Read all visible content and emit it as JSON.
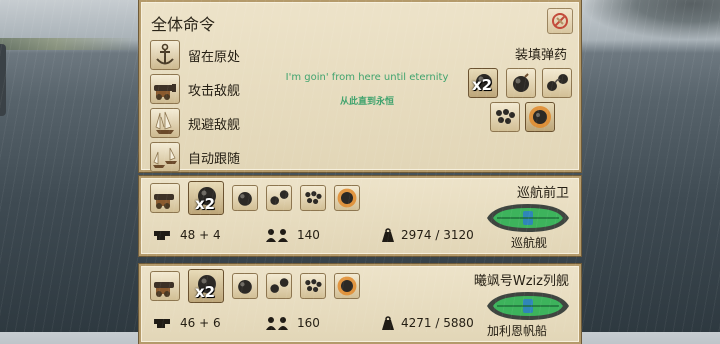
{
  "main": {
    "title": "全体命令",
    "orders": [
      {
        "label": "留在原处",
        "icon": "anchor-icon"
      },
      {
        "label": "攻击敌舰",
        "icon": "cannon-icon"
      },
      {
        "label": "规避敌舰",
        "icon": "sailing-ship-icon"
      },
      {
        "label": "自动跟随",
        "icon": "fleet-icon"
      }
    ],
    "quote_line1": "I'm goin' from here until eternity",
    "quote_line2": "从此直到永恒",
    "load_ammo_title": "装填弹药",
    "ammo": [
      {
        "icon": "cannonball-icon",
        "multiplier": "x2",
        "selected": true
      },
      {
        "icon": "bomb-icon"
      },
      {
        "icon": "chain-shot-icon"
      },
      {
        "icon": "grapeshot-icon"
      },
      {
        "icon": "explosive-shell-icon",
        "selected": true
      }
    ]
  },
  "ships": [
    {
      "name": "巡航前卫",
      "class": "巡航舰",
      "cannons": "48 + 4",
      "crew": "140",
      "cargo": "2974 / 3120",
      "multiplier": "x2"
    },
    {
      "name": "曦飒号Wziz列舰",
      "class": "加利恩帆船",
      "cannons": "46 + 6",
      "crew": "160",
      "cargo": "4271 / 5880",
      "multiplier": "x2"
    }
  ],
  "colors": {
    "panel": "#e8ddc1",
    "border": "#b49a6a",
    "quote": "#3fa36d",
    "hull_green": "#3db35c",
    "hull_blue": "#2f86b8"
  }
}
